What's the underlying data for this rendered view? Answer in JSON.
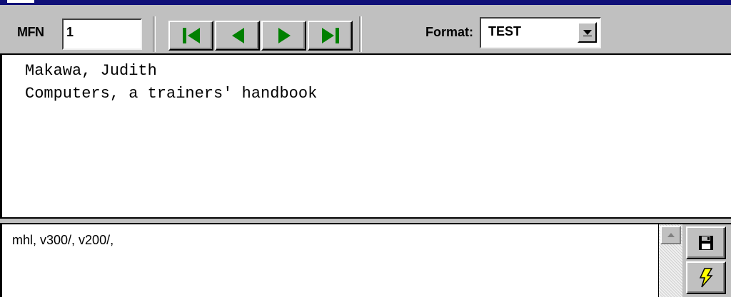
{
  "toolbar": {
    "mfn_label": "MFN",
    "mfn_value": "1",
    "nav_buttons": [
      {
        "name": "first-record-button",
        "icon": "first-record-icon"
      },
      {
        "name": "previous-record-button",
        "icon": "previous-record-icon"
      },
      {
        "name": "next-record-button",
        "icon": "next-record-icon"
      },
      {
        "name": "last-record-button",
        "icon": "last-record-icon"
      }
    ],
    "format_label": "Format:",
    "format_value": "TEST"
  },
  "display": {
    "lines": [
      "Makawa, Judith",
      "Computers, a trainers' handbook"
    ]
  },
  "editor": {
    "text": "mhl, v300/, v200/,"
  },
  "side_buttons": [
    {
      "name": "save-button",
      "icon": "floppy-disk-icon"
    },
    {
      "name": "execute-button",
      "icon": "lightning-icon"
    }
  ],
  "colors": {
    "nav_icon": "#008000",
    "face": "#c0c0c0",
    "title_bar": "#101078",
    "lightning": "#ffff00"
  }
}
